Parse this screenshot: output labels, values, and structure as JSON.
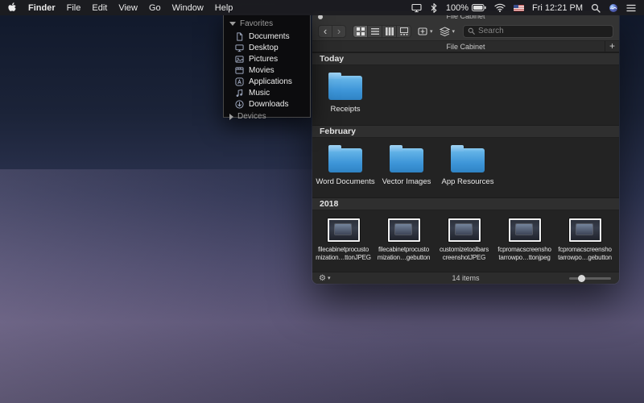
{
  "menu_bar": {
    "menus": [
      "Finder",
      "File",
      "Edit",
      "View",
      "Go",
      "Window",
      "Help"
    ],
    "status": {
      "battery": "100%",
      "clock": "Fri 12:21 PM"
    }
  },
  "sidebar": {
    "favorites_label": "Favorites",
    "devices_label": "Devices",
    "items": [
      "Documents",
      "Desktop",
      "Pictures",
      "Movies",
      "Applications",
      "Music",
      "Downloads"
    ]
  },
  "window": {
    "title": "File Cabinet",
    "toolbar": {
      "search_placeholder": "Search"
    },
    "pathbar": {
      "title": "File Cabinet",
      "add_label": "+"
    },
    "sections": [
      {
        "header": "Today",
        "items": [
          {
            "name": "Receipts"
          }
        ]
      },
      {
        "header": "February",
        "items": [
          {
            "name": "Word Documents"
          },
          {
            "name": "Vector Images"
          },
          {
            "name": "App Resources"
          }
        ]
      },
      {
        "header": "2018",
        "items": [
          {
            "line1": "filecabinetprocusto",
            "line2": "mization…ttonJPEG"
          },
          {
            "line1": "filecabinetprocusto",
            "line2": "mization…gebutton"
          },
          {
            "line1": "customizetoolbars",
            "line2": "creenshotJPEG"
          },
          {
            "line1": "fcpromacscreensho",
            "line2": "tarrowpo…ttonjpeg"
          },
          {
            "line1": "fcpromacscreensho",
            "line2": "tarrowpo…gebutton"
          }
        ]
      }
    ],
    "statusbar": {
      "count": "14 items"
    }
  },
  "glyphs": {
    "back": "‹",
    "forward": "›",
    "gear": "⚙",
    "caret_down": "▾"
  },
  "colors": {
    "folder_blue": "#3d95d8",
    "selected_segment": "#616161",
    "window_bg": "#262626"
  }
}
